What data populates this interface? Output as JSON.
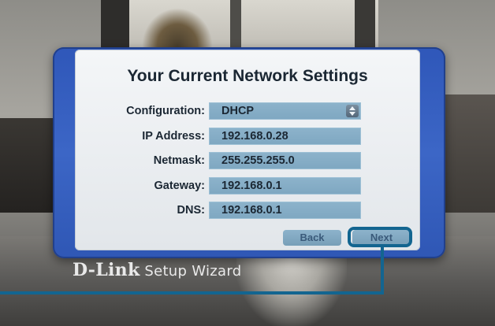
{
  "title": "Your Current Network Settings",
  "fields": [
    {
      "label": "Configuration:",
      "value": "DHCP"
    },
    {
      "label": "IP Address:",
      "value": "192.168.0.28"
    },
    {
      "label": "Netmask:",
      "value": "255.255.255.0"
    },
    {
      "label": "Gateway:",
      "value": "192.168.0.1"
    },
    {
      "label": "DNS:",
      "value": "192.168.0.1"
    }
  ],
  "buttons": {
    "back": "Back",
    "next": "Next"
  },
  "brand": {
    "logo": "D-Link",
    "text": "Setup Wizard"
  },
  "colors": {
    "frame": "#3c66c6",
    "field": "#8db3cb",
    "callout": "#136590"
  }
}
